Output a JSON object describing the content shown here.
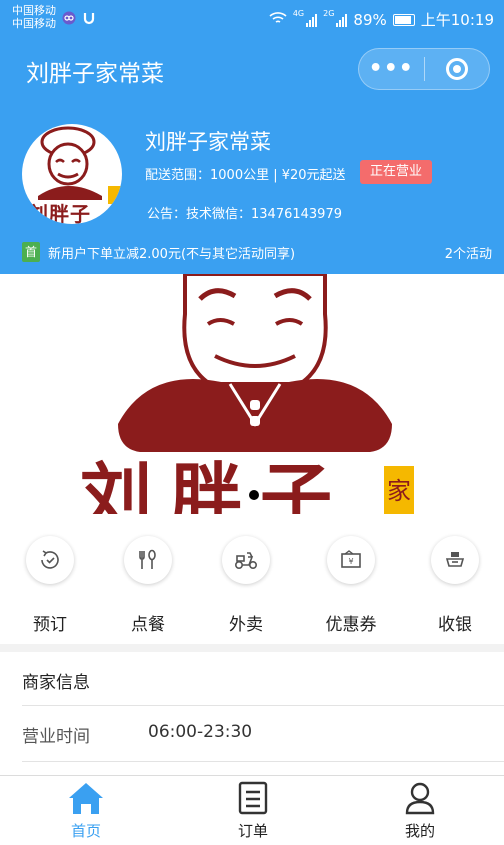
{
  "status_bar": {
    "carrier_1": "中国移动",
    "carrier_2": "中国移动",
    "network_1": "4G",
    "network_2": "2G",
    "battery": "89%",
    "time": "上午10:19"
  },
  "nav": {
    "title": "刘胖子家常菜",
    "more_label": "•••"
  },
  "shop": {
    "name": "刘胖子家常菜",
    "delivery_info": "配送范围：1000公里 | ¥20元起送",
    "status": "正在营业",
    "notice": "公告：技术微信：13476143979",
    "logo_text": "刘胖子",
    "logo_tag": "家"
  },
  "promo": {
    "tag": "首",
    "text": "新用户下单立减2.00元(不与其它活动同享)",
    "count": "2个活动"
  },
  "banner": {
    "brand_text": "刘胖子",
    "brand_tag": "家"
  },
  "quick_menu": [
    {
      "label": "预订",
      "icon": "clock-check-icon"
    },
    {
      "label": "点餐",
      "icon": "cutlery-icon"
    },
    {
      "label": "外卖",
      "icon": "scooter-icon"
    },
    {
      "label": "优惠券",
      "icon": "coupon-icon"
    },
    {
      "label": "收银",
      "icon": "cashier-icon"
    }
  ],
  "merchant_info": {
    "title": "商家信息",
    "hours_label": "营业时间",
    "hours_value": "06:00-23:30"
  },
  "tabbar": [
    {
      "label": "首页",
      "active": true
    },
    {
      "label": "订单",
      "active": false
    },
    {
      "label": "我的",
      "active": false
    }
  ],
  "colors": {
    "primary": "#3aa0f1",
    "status_badge": "#f46c6c",
    "promo_tag": "#4caf50",
    "brand_red": "#8b1c1c"
  }
}
